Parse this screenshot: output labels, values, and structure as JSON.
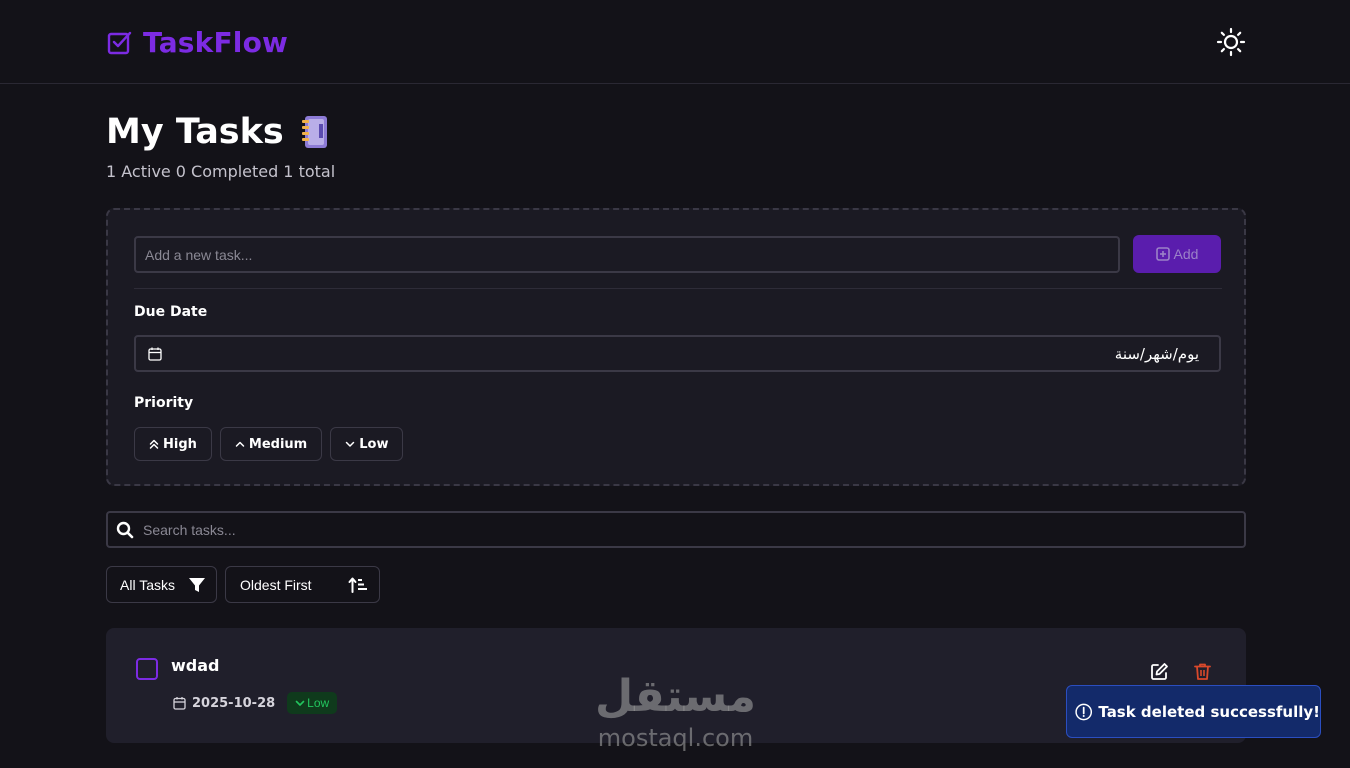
{
  "header": {
    "brand": "TaskFlow",
    "brand_color": "#7c2be3"
  },
  "page": {
    "title": "My Tasks",
    "stats": {
      "active": "1 Active",
      "completed": "0 Completed",
      "total": "1 total"
    }
  },
  "add_form": {
    "placeholder": "Add a new task...",
    "add_label": "Add",
    "due_date_label": "Due Date",
    "due_date_value": "يوم/شهر/سنة",
    "priority_label": "Priority",
    "priorities": [
      "High",
      "Medium",
      "Low"
    ]
  },
  "search": {
    "placeholder": "Search tasks..."
  },
  "filters": {
    "status": "All Tasks",
    "sort": "Oldest First"
  },
  "tasks": [
    {
      "title": "wdad",
      "due": "2025-10-28",
      "priority": "Low",
      "completed": false
    }
  ],
  "watermark": {
    "arabic": "مستقل",
    "latin": "mostaql.com"
  },
  "toast": {
    "message": "Task deleted successfully!"
  },
  "colors": {
    "background": "#131218",
    "accent": "#7c2be3",
    "add_button": "#5a1dad",
    "low_badge_bg": "#0f3a1c",
    "low_badge_text": "#22c55e",
    "delete": "#d9482b",
    "toast_bg": "#132a6a"
  }
}
